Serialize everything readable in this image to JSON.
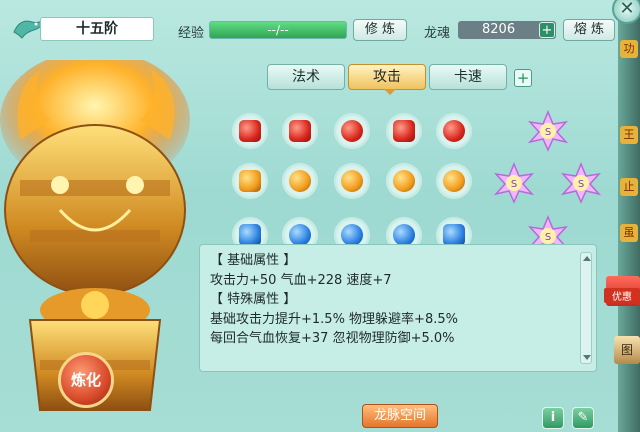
{
  "header": {
    "tier": "十五阶",
    "exp_label": "经验",
    "exp_value": "--/--",
    "cultivate_button": "修 炼",
    "soul_label": "龙魂",
    "soul_value": "8206",
    "smelt_button": "熔 炼"
  },
  "tabs": [
    {
      "label": "法术",
      "active": false
    },
    {
      "label": "攻击",
      "active": true
    },
    {
      "label": "卡速",
      "active": false
    }
  ],
  "gem_rows": [
    {
      "color": "red",
      "gems": [
        "square",
        "square",
        "round",
        "square",
        "round"
      ]
    },
    {
      "color": "orange",
      "gems": [
        "square",
        "round",
        "round",
        "round",
        "round"
      ]
    },
    {
      "color": "blue",
      "gems": [
        "square",
        "round",
        "round",
        "round",
        "square"
      ]
    }
  ],
  "info": {
    "base_header": "【 基础属性 】",
    "base_stats": "攻击力+50  气血+228  速度+7",
    "special_header": "【 特殊属性 】",
    "special_line1": "基础攻击力提升+1.5%  物理躲避率+8.5%",
    "special_line2": "每回合气血恢复+37  忽视物理防御+5.0%"
  },
  "footer": {
    "refine_button": "炼化",
    "dragon_vein_button": "龙脉空间",
    "info_icon": "i",
    "edit_icon": "edit-icon"
  },
  "side": {
    "promo_label": "优惠",
    "guide_label": "图"
  },
  "colors": {
    "accent_gold": "#f0c25e",
    "exp_green": "#2fa555",
    "panel_bg": "#9edad2"
  }
}
